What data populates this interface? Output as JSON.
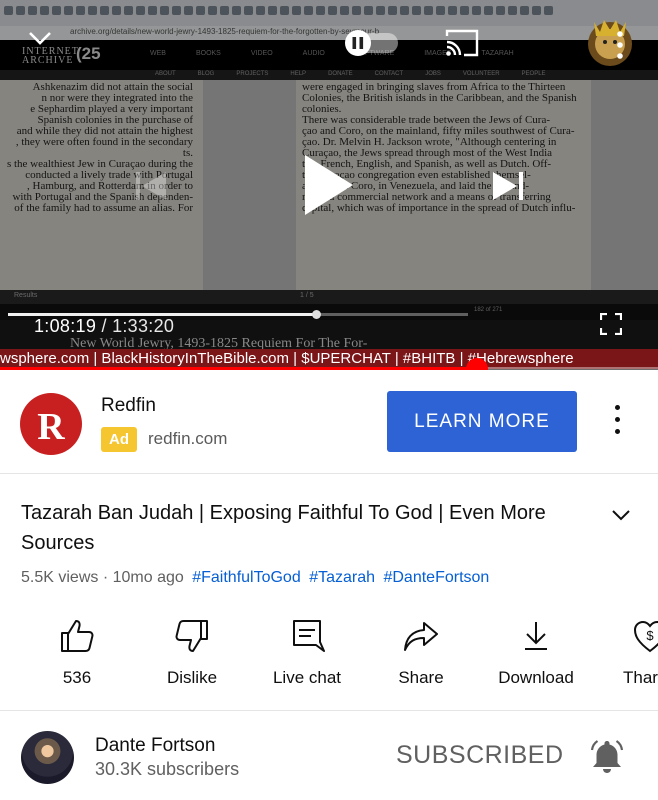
{
  "player": {
    "url": "archive.org/details/new-world-jewry-1493-1825-requiem-for-the-forgotten-by-seymour-b",
    "ia_logo_line1": "INTERNET",
    "ia_logo_line2": "ARCHIVE",
    "ia_anniversary": "(25",
    "ia_nav": [
      "WEB",
      "BOOKS",
      "VIDEO",
      "AUDIO",
      "SOFTWARE",
      "IMAGES",
      "TAZARAH"
    ],
    "ia_subnav": [
      "ABOUT",
      "BLOG",
      "PROJECTS",
      "HELP",
      "DONATE",
      "CONTACT",
      "JOBS",
      "VOLUNTEER",
      "PEOPLE"
    ],
    "left_page_lines": [
      "Ashkenazim did not attain the social",
      "n nor were they integrated into the",
      "e Sephardim played a very important",
      "Spanish colonies in the purchase of",
      "and while they did not attain the highest",
      ", they were often found in the secondary",
      "ts.",
      "s the wealthiest Jew in Curaçao during the",
      "conducted a lively trade with Portugal",
      ", Hamburg, and Rotterdam in order to",
      "with Portugal and the Spanish dependen-",
      "of the family had to assume an alias. For"
    ],
    "right_page_lines": [
      "were engaged in bringing slaves from Africa to the Thirteen",
      "Colonies, the British islands in the Caribbean, and the Spanish",
      "colonies.",
      "There was considerable trade between the Jews of Cura-",
      "çao and Coro, on the mainland, fifty miles southwest of Cura-",
      "çao. Dr. Melvin H. Jackson wrote, \"Although centering in",
      "Curaçao, the Jews spread through most of the West India",
      "ts... French, English, and Spanish, as well as Dutch. Off-",
      "the Curaçao congregation even established themsel-",
      "aracas and Coro, in Venezuela, and laid the ground-",
      "rk for a commercial network and a means of transferring",
      "capital, which was of importance in the spread of Dutch influ-"
    ],
    "results_label": "Results",
    "pager_label": "1 / 5",
    "page_count": "182 of 271",
    "current_time": "1:08:19",
    "duration": "1:33:20",
    "separator": " / ",
    "progress_fraction": 0.725,
    "mini_scrub_fraction": 0.67,
    "under_title": "New World Jewry, 1493-1825 Requiem For The For-",
    "ticker": "wsphere.com | BlackHistoryInTheBible.com | $UPERCHAT | #BHITB | #Hebrewsphere"
  },
  "ad": {
    "logo_letter": "R",
    "advertiser": "Redfin",
    "badge": "Ad",
    "domain": "redfin.com",
    "cta": "LEARN MORE",
    "accent": "#2d63d4",
    "logo_color": "#c82021"
  },
  "video": {
    "title": "Tazarah Ban Judah | Exposing Faithful To God | Even More Sources",
    "views": "5.5K views",
    "dot": " · ",
    "age": "10mo ago",
    "hashtags": [
      "#FaithfulToGod",
      "#Tazarah",
      "#DanteFortson"
    ]
  },
  "actions": [
    {
      "icon": "thumbs-up-icon",
      "label": "536"
    },
    {
      "icon": "thumbs-down-icon",
      "label": "Dislike"
    },
    {
      "icon": "live-chat-icon",
      "label": "Live chat"
    },
    {
      "icon": "share-icon",
      "label": "Share"
    },
    {
      "icon": "download-icon",
      "label": "Download"
    },
    {
      "icon": "thanks-icon",
      "label": "Thar"
    }
  ],
  "channel": {
    "name": "Dante Fortson",
    "subscribers": "30.3K subscribers",
    "subscribe_state": "SUBSCRIBED"
  }
}
